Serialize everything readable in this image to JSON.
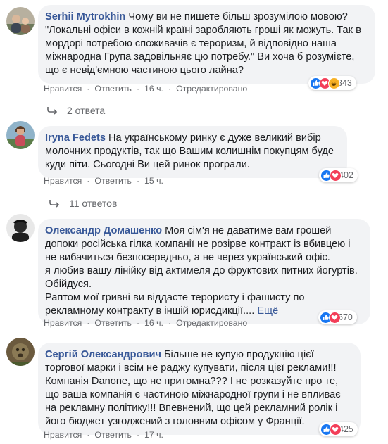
{
  "colors": {
    "link": "#385898",
    "meta": "#65676b",
    "bubble": "#f2f3f5",
    "like": "#1877f2",
    "love": "#f33e58",
    "haha": "#f7b125"
  },
  "comments": [
    {
      "author": "Serhii Mytrokhin",
      "paragraphs": [
        "Чому ви не пишете більш зрозумілою мовою? \"Локальні офіси в кожній країні заробляють гроші як можуть. Так в мордорі потребою споживачів є тероризм, й відповідно наша міжнародна Група задовільняє цю потребу.\" Ви хоча б розумієте, що є невід'ємною частиною цього лайна?"
      ],
      "more": "",
      "reaction_icons": [
        "like-icon",
        "love-icon",
        "haha-icon"
      ],
      "reaction_count": "343",
      "actions": {
        "like": "Нравится",
        "reply": "Ответить",
        "time": "16 ч.",
        "edited": "Отредактировано"
      },
      "replies": "2 ответа"
    },
    {
      "author": "Iryna Fedets",
      "paragraphs": [
        "На українському ринку є дуже великий вибір молочних продуктів, так що Вашим колишнім покупцям буде куди піти. Сьогодні Ви цей ринок програли."
      ],
      "more": "",
      "reaction_icons": [
        "like-icon",
        "love-icon"
      ],
      "reaction_count": "402",
      "actions": {
        "like": "Нравится",
        "reply": "Ответить",
        "time": "15 ч.",
        "edited": ""
      },
      "replies": "11 ответов"
    },
    {
      "author": "Олександр Домашенко",
      "paragraphs": [
        "Моя сім'я не даватиме вам грошей допоки російська гілка компанії не розірве контракт із вбивцею і не вибачиться безпосередньо, а не через український офіс.",
        "я любив вашу лінійку від актимеля до фруктових питних йогуртів. Обійдуся.",
        "Раптом мої гривні ви віддасте терористу і фашисту по рекламному контракту в іншій юрисдикції...."
      ],
      "more": "Ещё",
      "reaction_icons": [
        "like-icon",
        "love-icon"
      ],
      "reaction_count": "570",
      "actions": {
        "like": "Нравится",
        "reply": "Ответить",
        "time": "16 ч.",
        "edited": "Отредактировано"
      },
      "replies": ""
    },
    {
      "author": "Сергій Олександрович",
      "paragraphs": [
        "Більше не купую продукцію цієї торгової марки і всім не раджу купувати, після цієї реклами!!! Компанія Danone, що не притомна??? І не розказуйте про те, що ваша компанія є частиною міжнародної групи і не впливає на рекламну політику!!! Впевнений, що цей рекламний ролік і його бюджет узгоджений з головним офісом у Франції."
      ],
      "more": "",
      "reaction_icons": [
        "like-icon",
        "love-icon"
      ],
      "reaction_count": "425",
      "actions": {
        "like": "Нравится",
        "reply": "Ответить",
        "time": "17 ч.",
        "edited": ""
      },
      "replies": ""
    }
  ]
}
